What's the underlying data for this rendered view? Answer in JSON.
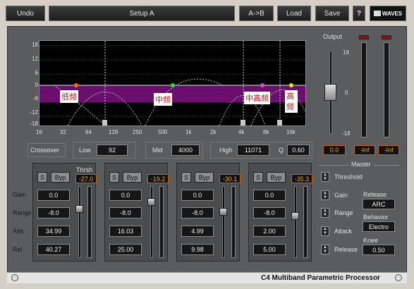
{
  "topbar": {
    "undo": "Undo",
    "setup": "Setup A",
    "ab": "A->B",
    "load": "Load",
    "save": "Save",
    "help": "?",
    "logo": "WAVES"
  },
  "graph": {
    "yticks": [
      "18",
      "12",
      "6",
      "0",
      "-6",
      "-12",
      "-18"
    ],
    "xticks": [
      "16",
      "32",
      "64",
      "128",
      "250",
      "500",
      "1k",
      "2k",
      "4k",
      "8k",
      "16k"
    ],
    "band_labels": [
      "低频",
      "中频",
      "中高频",
      "高频"
    ]
  },
  "crossover": {
    "title": "Crossover",
    "low_label": "Low",
    "low_value": "92",
    "mid_label": "Mid",
    "mid_value": "4000",
    "high_label": "High",
    "high_value": "11071",
    "q_label": "Q",
    "q_value": "0.60"
  },
  "output": {
    "title": "Output",
    "scale": [
      "18",
      "0",
      "-18"
    ],
    "gain_value": "0.0",
    "meter_left": "-Inf",
    "meter_right": "-Inf"
  },
  "row_labels": [
    "Gain",
    "Range",
    "Attk",
    "Rel"
  ],
  "thrsh_label": "Thrsh",
  "solo_label": "S",
  "bypass_label": "Byp",
  "bands": [
    {
      "thrsh": "-27.0",
      "gain": "0.0",
      "range": "-8.0",
      "attack": "34.99",
      "release": "40.27",
      "thrsh_level": 0.69
    },
    {
      "thrsh": "-19.2",
      "gain": "0.0",
      "range": "-8.0",
      "attack": "16.03",
      "release": "25.00",
      "thrsh_level": 0.78
    },
    {
      "thrsh": "-30.1",
      "gain": "0.0",
      "range": "-8.0",
      "attack": "4.99",
      "release": "9.98",
      "thrsh_level": 0.65
    },
    {
      "thrsh": "-35.3",
      "gain": "0.0",
      "range": "-8.0",
      "attack": "2.00",
      "release": "5.00",
      "thrsh_level": 0.59
    }
  ],
  "master": {
    "title": "Master",
    "threshold": "Threshold",
    "gain": "Gain",
    "range": "Range",
    "attack": "Attack",
    "release": "Release",
    "release_mode_label": "Release",
    "release_mode_value": "ARC",
    "behavior_label": "Behavior",
    "behavior_value": "Electro",
    "knee_label": "Knee",
    "knee_value": "0.50"
  },
  "footer": {
    "title": "C4 Multiband Parametric Processor"
  },
  "colors": {
    "band_fill": "#6a0f6e",
    "graph_bg": "#000000",
    "value_orange": "#f2a21e"
  }
}
